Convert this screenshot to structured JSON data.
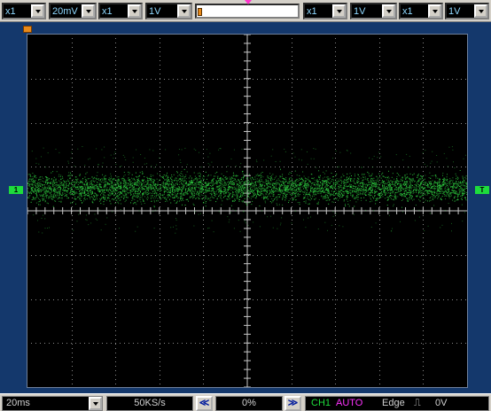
{
  "toolbar": {
    "ch1_probe": "x1",
    "ch1_volts": "20mV",
    "ch2_probe": "x1",
    "ch2_volts": "1V",
    "ch3_probe": "x1",
    "ch3_volts": "1V",
    "ch4_probe": "x1",
    "ch4_volts": "1V"
  },
  "markers": {
    "ch1": "1",
    "trigger_level": "T"
  },
  "statusbar": {
    "timebase": "20ms",
    "sample_rate": "50KS/s",
    "scroll_left": "≪",
    "position": "0%",
    "scroll_right": "≫",
    "trig_channel": "CH1",
    "trig_mode": "AUTO",
    "trig_type": "Edge",
    "trig_slope": "⎍",
    "trig_level": "0V"
  },
  "colors": {
    "background": "#14386c",
    "screen": "#000000",
    "trace": "#2ecc40",
    "grid": "#8a8a8a",
    "probe_text": "#8fd8ff",
    "trig_channel": "#1edc3c",
    "trig_mode": "#ff33ff"
  }
}
